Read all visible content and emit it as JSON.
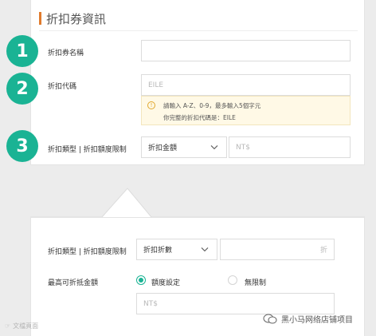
{
  "section": {
    "title": "折扣券資訊"
  },
  "steps": [
    "1",
    "2",
    "3"
  ],
  "coupon_name": {
    "label": "折扣券名稱",
    "value": ""
  },
  "coupon_code": {
    "label": "折扣代碼",
    "placeholder": "EILE",
    "hint_icon": "info-icon",
    "hint_line1": "請輸入 A-Z、0-9，最多輸入5個字元",
    "hint_line2": "你完整的折扣代碼是：EILE"
  },
  "discount_type": {
    "label": "折扣類型 | 折扣額度限制",
    "select_value": "折扣金額",
    "amount_placeholder": "NT$"
  },
  "bottom": {
    "discount_type": {
      "label": "折扣類型 | 折扣額度限制",
      "select_value": "折扣折數",
      "unit": "折"
    },
    "max_amount": {
      "label": "最高可折抵金額",
      "option_limit": "額度設定",
      "option_unlimited": "無限制",
      "selected": "額度設定",
      "input_placeholder": "NT$"
    }
  },
  "watermarks": {
    "left": "文檔頁面",
    "right": "黑小马网络店铺项目"
  },
  "colors": {
    "accent": "#1ab394",
    "title_bar": "#e07b2d",
    "hint_bg": "#fff9e6",
    "hint_icon": "#e1a82f"
  }
}
